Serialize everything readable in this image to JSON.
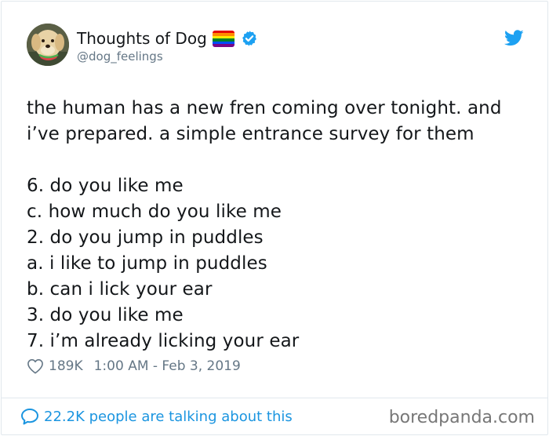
{
  "author": {
    "display_name": "Thoughts of Dog",
    "handle": "@dog_feelings",
    "avatar_icon": "dog-with-watermelon-avatar",
    "verified": true,
    "flag_icon": "rainbow-pride-flag"
  },
  "tweet": {
    "lines": [
      "the human has a new fren coming over tonight. and",
      "i’ve prepared. a simple entrance survey for them",
      "",
      "6. do you like me",
      "c. how much do you like me",
      "2. do you jump in puddles",
      "a. i like to jump in puddles",
      "b. can i lick your ear",
      "3. do you like me",
      "7. i’m already licking your ear"
    ],
    "like_count": "189K",
    "timestamp": "1:00 AM - Feb 3, 2019"
  },
  "footer": {
    "talking_text": "22.2K people are talking about this",
    "watermark": "boredpanda.com"
  },
  "colors": {
    "link_blue": "#1b95e0",
    "twitter_blue": "#1da1f2",
    "muted": "#657786",
    "text": "#14171a",
    "border": "#e1e8ed"
  }
}
